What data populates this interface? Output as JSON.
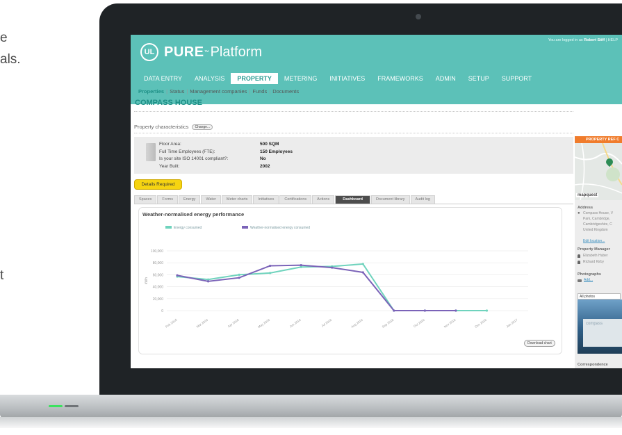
{
  "background_text": {
    "line1": "e",
    "line2": "als.",
    "line3": "t"
  },
  "app": {
    "logo_ul": "UL",
    "logo_pure": "PURE",
    "logo_tm": "™",
    "logo_platform": "Platform",
    "logged_in_prefix": "You are logged in as",
    "logged_in_user": "Robert Stiff",
    "help_label": "| HELP"
  },
  "nav": {
    "items": [
      "DATA ENTRY",
      "ANALYSIS",
      "PROPERTY",
      "METERING",
      "INITIATIVES",
      "FRAMEWORKS",
      "ADMIN",
      "SETUP",
      "SUPPORT"
    ],
    "active": "PROPERTY"
  },
  "subnav": {
    "items": [
      "Properties",
      "Status",
      "Management companies",
      "Funds",
      "Documents"
    ],
    "active": "Properties"
  },
  "page": {
    "title": "COMPASS HOUSE",
    "characteristics_label": "Property characteristics",
    "change_label": "Change..."
  },
  "property": {
    "rows": [
      {
        "label": "Floor Area:",
        "value": "500 SQM"
      },
      {
        "label": "Full Time Employees (FTE):",
        "value": "150 Employees"
      },
      {
        "label": "Is your site ISO 14001 compliant?:",
        "value": "No"
      },
      {
        "label": "Year Built:",
        "value": "2002"
      }
    ],
    "details_button": "Details Required"
  },
  "tabs": {
    "items": [
      "Spaces",
      "Forms",
      "Energy",
      "Water",
      "Meter charts",
      "Initiatives",
      "Certifications",
      "Actions",
      "Dashboard",
      "Document library",
      "Audit log"
    ],
    "active": "Dashboard"
  },
  "chart_card": {
    "title": "Weather-normalised energy performance",
    "download_label": "Download chart"
  },
  "chart_data": {
    "type": "line",
    "title": "Weather-normalised energy performance",
    "ylabel": "kWh",
    "ylim": [
      0,
      100000
    ],
    "yticks": [
      "0",
      "20,000",
      "40,000",
      "60,000",
      "80,000",
      "100,000"
    ],
    "categories": [
      "Feb 2016",
      "Mar 2016",
      "Apr 2016",
      "May 2016",
      "Jun 2016",
      "Jul 2016",
      "Aug 2016",
      "Sep 2016",
      "Oct 2016",
      "Nov 2016",
      "Dec 2016",
      "Jan 2017"
    ],
    "series": [
      {
        "name": "Energy consumed",
        "color": "#6fd3bd",
        "values": [
          57000,
          52000,
          60000,
          63000,
          73000,
          74000,
          78000,
          0,
          0,
          0,
          0,
          null
        ]
      },
      {
        "name": "Weather-normalised energy consumed",
        "color": "#7b63b8",
        "values": [
          59000,
          49000,
          55000,
          75000,
          76000,
          72000,
          64000,
          0,
          0,
          0,
          null,
          null
        ]
      }
    ],
    "grid": true,
    "legend": "top-left"
  },
  "sidebar": {
    "header": "PROPERTY REF C",
    "map_logo": "mapquest",
    "address_label": "Address",
    "address_lines": [
      "Compass House, V",
      "Park, Cambridge,",
      "Cambridgeshire, C",
      "United Kingdom"
    ],
    "edit_location": "Edit location...",
    "manager_label": "Property Manager",
    "managers": [
      "Elizabeth Huber",
      "Richard Kirby"
    ],
    "photographs_label": "Photographs",
    "add_label": "Add...",
    "photos_select": "All photos",
    "correspondence_label": "Correspondence"
  },
  "colors": {
    "brand_teal": "#5cc1b8",
    "title_teal": "#1d8f86",
    "orange": "#f07c2c",
    "yellow_button": "#f6d411"
  }
}
